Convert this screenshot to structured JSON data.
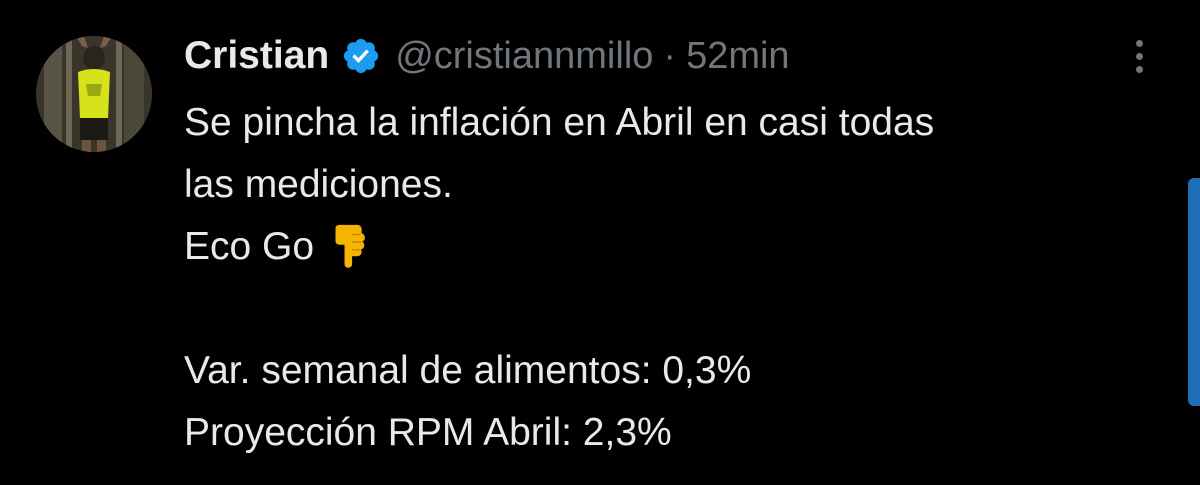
{
  "tweet": {
    "author_name": "Cristian",
    "handle": "@cristiannmillo",
    "separator": "·",
    "time": "52min",
    "verified": true,
    "lines": [
      "Se pincha la inflación en Abril en casi todas",
      "las mediciones.",
      "Eco Go"
    ],
    "stats": [
      "Var. semanal de alimentos: 0,3%",
      "Proyección RPM Abril: 2,3%"
    ],
    "emoji": "pointing-down-hand-icon"
  },
  "colors": {
    "background": "#000000",
    "primary_text": "#e7e9ea",
    "secondary_text": "#71767b",
    "verified_badge": "#1d9bf0",
    "emoji": "#f4b400",
    "scroll_indicator": "#1d6fb8"
  },
  "icons": {
    "verified": "verified-badge-icon",
    "more": "more-options-icon"
  }
}
